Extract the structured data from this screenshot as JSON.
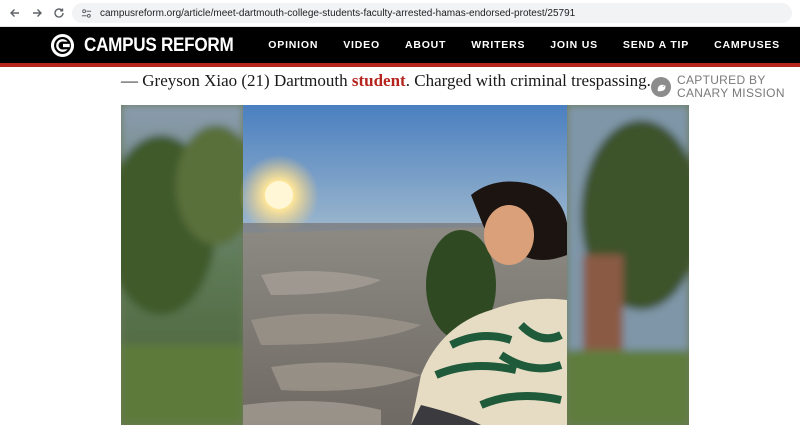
{
  "browser": {
    "url": "campusreform.org/article/meet-dartmouth-college-students-faculty-arrested-hamas-endorsed-protest/25791"
  },
  "header": {
    "logo_text": "CAMPUS REFORM",
    "nav": [
      "OPINION",
      "VIDEO",
      "ABOUT",
      "WRITERS",
      "JOIN US",
      "SEND A TIP",
      "CAMPUSES"
    ],
    "accent_color": "#b5251e"
  },
  "article": {
    "caption_prefix": "— Greyson Xiao (21) Dartmouth ",
    "caption_link": "student",
    "caption_suffix": ". Charged with criminal trespassing.",
    "credit_line1": "CAPTURED BY",
    "credit_line2": "CANARY MISSION"
  },
  "icons": {
    "back": "arrow-left-icon",
    "forward": "arrow-right-icon",
    "reload": "reload-icon",
    "site_info": "site-info-icon",
    "logo": "campus-reform-logo-icon",
    "credit": "canary-bird-icon"
  }
}
